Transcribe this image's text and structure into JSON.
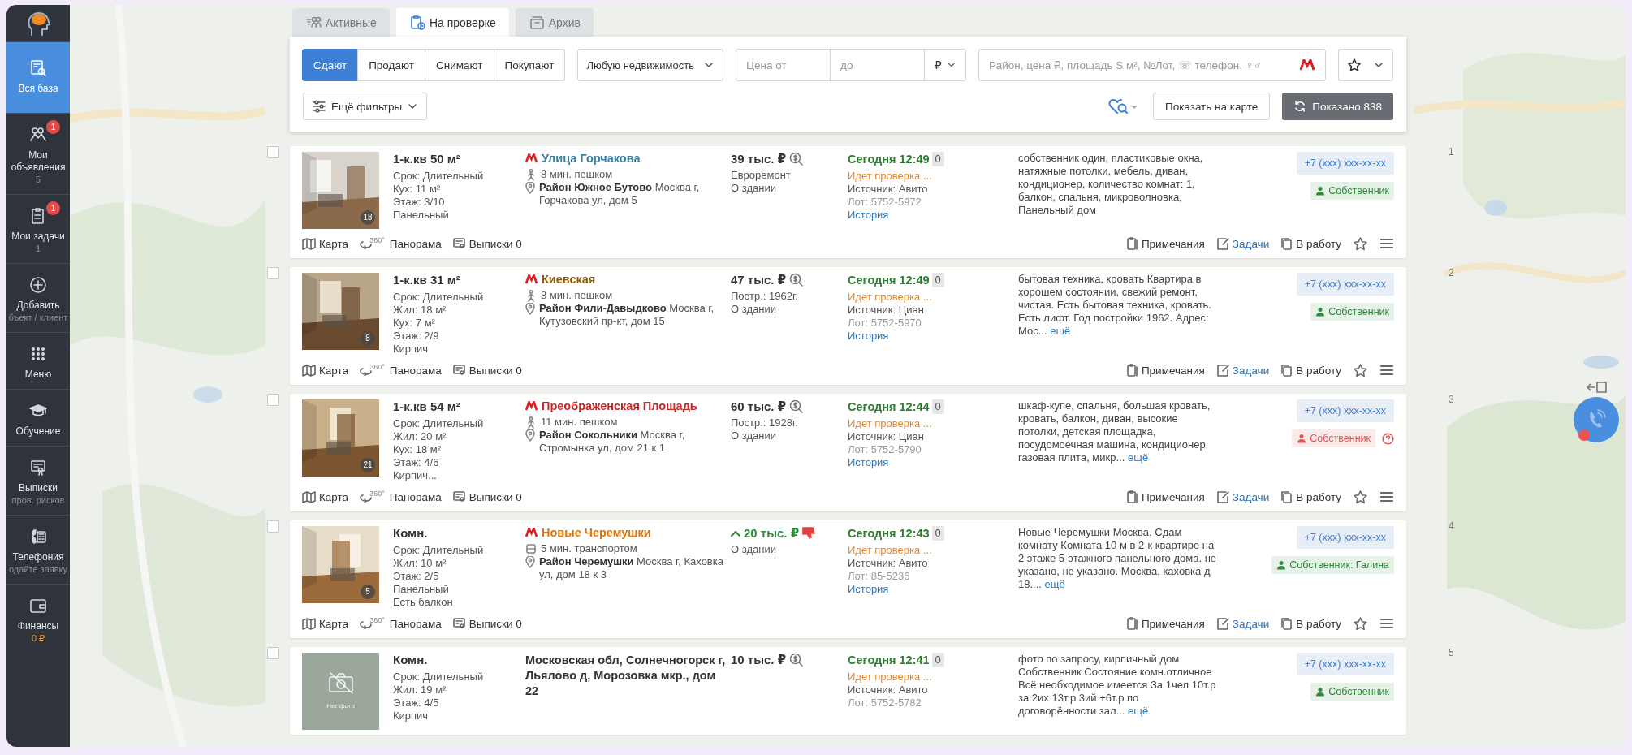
{
  "sidebar": {
    "items": [
      {
        "label": "Вся база",
        "selected": true
      },
      {
        "label": "Мои объявления",
        "sublabel": "5",
        "highlight": false,
        "badge": "1",
        "selected": false
      },
      {
        "label": "Мои задачи",
        "sublabel": "1",
        "highlight": false,
        "badge": "1",
        "selected": false
      },
      {
        "label": "Добавить",
        "sublabel": "бъект / клиент",
        "highlight": false,
        "selected": false
      },
      {
        "label": "Меню",
        "selected": false
      },
      {
        "label": "Обучение",
        "selected": false
      },
      {
        "label": "Выписки",
        "sublabel": "пров. рисков",
        "highlight": false,
        "selected": false
      },
      {
        "label": "Телефония",
        "sublabel": "одайте заявку",
        "highlight": false,
        "selected": false
      },
      {
        "label": "Финансы",
        "sublabel": "0 ₽",
        "highlight": true,
        "selected": false
      }
    ]
  },
  "tabs": [
    {
      "label": "Активные",
      "selected": false
    },
    {
      "label": "На проверке",
      "selected": true
    },
    {
      "label": "Архив",
      "selected": false
    }
  ],
  "filters": {
    "deal_types": [
      {
        "label": "Сдают",
        "selected": true
      },
      {
        "label": "Продают",
        "selected": false
      },
      {
        "label": "Снимают",
        "selected": false
      },
      {
        "label": "Покупают",
        "selected": false
      }
    ],
    "property_type": "Любую недвижимость",
    "price_from": {
      "placeholder": "Цена от"
    },
    "price_to": {
      "placeholder": "до"
    },
    "currency": "₽",
    "search": {
      "placeholder": "Район, цена ₽, площадь S м², №Лот, ☏ телефон, ♀♂"
    },
    "more_filters": "Ещё фильтры",
    "show_on_map": "Показать на карте",
    "shown": "Показано 838"
  },
  "listings": [
    {
      "number": "1",
      "checked": false,
      "photo": {
        "kind": "picture",
        "count": "18"
      },
      "title": "1-к.кв 50 м²",
      "details": [
        "Срок: Длительный",
        "Кух: 11 м²",
        "Этаж: 3/10",
        "Панельный"
      ],
      "location": {
        "kind": "metro",
        "station": "Улица Горчакова",
        "color": "#3b7fa3",
        "route": {
          "kind": "walk",
          "text": "8 мин. пешком"
        },
        "address": "**Район Южное Бутово** Москва г, Горчакова ул, дом 5"
      },
      "price": "39 тыс. ₽",
      "price_rising": false,
      "price_badge": {
        "kind": "inspect"
      },
      "price_notes": [
        "Евроремонт",
        "О здании"
      ],
      "date": "Сегодня 12:49",
      "views": "0",
      "status": "Идет проверка ...",
      "source": "Источник: Авито",
      "lot": "Лот: 5752-5972",
      "history": "История",
      "description": "собственник один, пластиковые окна, натяжные потолки, мебель, диван, кондиционер, количество комнат: 1, балкон, спальня, микроволновка, Панельный дом",
      "phone": "+7 (xxx) xxx-xx-xx",
      "owner": {
        "label": "Собственник",
        "color": "#2e8b3a",
        "help": false
      },
      "actions": {
        "map": "Карта",
        "panorama_badge": "360°",
        "panorama": "Панорама",
        "extracts": "Выписки 0",
        "notes": "Примечания",
        "tasks": "Задачи",
        "to_work": "В работу"
      }
    },
    {
      "number": "2",
      "checked": false,
      "photo": {
        "kind": "picture",
        "count": "8"
      },
      "title": "1-к.кв 31 м²",
      "details": [
        "Срок: Длительный",
        "Жил: 18 м²",
        "Кух: 7 м²",
        "Этаж: 2/9",
        "Кирпич"
      ],
      "location": {
        "kind": "metro",
        "station": "Киевская",
        "color": "#8a5a0b",
        "route": {
          "kind": "walk",
          "text": "8 мин. пешком"
        },
        "address": "**Район Фили-Давыдково** Москва г, Кутузовский пр-кт, дом 15"
      },
      "price": "47 тыс. ₽",
      "price_rising": false,
      "price_badge": {
        "kind": "inspect"
      },
      "price_notes": [
        "Постр.: 1962г.",
        "О здании"
      ],
      "date": "Сегодня 12:49",
      "views": "0",
      "status": "Идет проверка ...",
      "source": "Источник: Циан",
      "lot": "Лот: 5752-5970",
      "history": "История",
      "description": "бытовая техника, кровать Квартира в хорошем состоянии, свежий ремонт, чистая. Есть бытовая техника, кровать. Есть лифт. Год постройки 1962. Адрес: Мос...",
      "more": "ещё",
      "phone": "+7 (xxx) xxx-xx-xx",
      "owner": {
        "label": "Собственник",
        "color": "#2e8b3a",
        "help": false
      },
      "actions": {
        "map": "Карта",
        "panorama_badge": "360°",
        "panorama": "Панорама",
        "extracts": "Выписки 0",
        "notes": "Примечания",
        "tasks": "Задачи",
        "to_work": "В работу"
      }
    },
    {
      "number": "3",
      "checked": false,
      "photo": {
        "kind": "picture",
        "count": "21"
      },
      "title": "1-к.кв 54 м²",
      "details": [
        "Срок: Длительный",
        "Жил: 20 м²",
        "Кух: 18 м²",
        "Этаж: 4/6",
        "Кирпич..."
      ],
      "location": {
        "kind": "metro",
        "station": "Преображенская Площадь",
        "color": "#c62828",
        "route": {
          "kind": "walk",
          "text": "11 мин. пешком"
        },
        "address": "**Район Сокольники** Москва г, Стромынка ул, дом 21 к 1"
      },
      "price": "60 тыс. ₽",
      "price_rising": false,
      "price_badge": {
        "kind": "inspect"
      },
      "price_notes": [
        "Постр.: 1928г.",
        "О здании"
      ],
      "date": "Сегодня 12:44",
      "views": "0",
      "status": "Идет проверка ...",
      "source": "Источник: Циан",
      "lot": "Лот: 5752-5790",
      "history": "История",
      "description": "шкаф-купе, спальня, большая кровать, кровать, балкон, диван, высокие потолки, детская площадка, посудомоечная машина, кондиционер, газовая плита, микр...",
      "more": "ещё",
      "phone": "+7 (xxx) xxx-xx-xx",
      "owner": {
        "label": "Собственник",
        "color": "#e05555",
        "help": true
      },
      "actions": {
        "map": "Карта",
        "panorama_badge": "360°",
        "panorama": "Панорама",
        "extracts": "Выписки 0",
        "notes": "Примечания",
        "tasks": "Задачи",
        "to_work": "В работу"
      }
    },
    {
      "number": "4",
      "checked": false,
      "photo": {
        "kind": "picture",
        "count": "5"
      },
      "title": "Комн.",
      "details": [
        "Срок: Длительный",
        "Жил: 10 м²",
        "Этаж: 2/5",
        "Панельный",
        "Есть балкон"
      ],
      "location": {
        "kind": "metro",
        "station": "Новые Черемушки",
        "color": "#d9770a",
        "route": {
          "kind": "transport",
          "text": "5 мин. транспортом"
        },
        "address": "**Район Черемушки** Москва г, Каховка ул, дом 18 к 3"
      },
      "price": "20 тыс. ₽",
      "price_rising": true,
      "price_badge": {
        "kind": "dislike"
      },
      "price_notes": [
        "О здании"
      ],
      "date": "Сегодня 12:43",
      "views": "0",
      "status": "Идет проверка ...",
      "source": "Источник: Авито",
      "lot": "Лот: 85-5236",
      "history": "История",
      "description": "Новые Черемушки Москва. Сдам комнату Комната 10 м в 2-к квартире на 2 этаже 5-этажного панельного дома. не указано, не указано. Москва, каховка д 18....",
      "more": "ещё",
      "phone": "+7 (xxx) xxx-xx-xx",
      "owner": {
        "label": "Собственник: Галина",
        "color": "#2e8b3a",
        "help": false
      },
      "actions": {
        "map": "Карта",
        "panorama_badge": "360°",
        "panorama": "Панорама",
        "extracts": "Выписки 0",
        "notes": "Примечания",
        "tasks": "Задачи",
        "to_work": "В работу"
      }
    },
    {
      "number": "5",
      "checked": false,
      "photo": {
        "kind": "empty",
        "label": "Нет фото"
      },
      "title": "Комн.",
      "details": [
        "Срок: Длительный",
        "Жил: 19 м²",
        "Этаж: 4/5",
        "Кирпич"
      ],
      "location": {
        "kind": "region",
        "address": "Московская обл, Солнечногорск г, Льялово д, Морозовка мкр., дом 22"
      },
      "price": "10 тыс. ₽",
      "price_rising": false,
      "price_badge": {
        "kind": "inspect"
      },
      "date": "Сегодня 12:41",
      "views": "0",
      "status": "Идет проверка ...",
      "source": "Источник: Авито",
      "lot": "Лот: 5752-5782",
      "description": "фото по запросу, кирпичный дом Собственник Состояние комн.отличное Всё необходимое имеется За 1чел 10т.р за 2их 13т.р 3ий +6т.р по договорённости зал...",
      "more": "ещё",
      "phone": "+7 (xxx) xxx-xx-xx",
      "owner": {
        "label": "Собственник",
        "color": "#2e8b3a",
        "help": false
      }
    }
  ]
}
